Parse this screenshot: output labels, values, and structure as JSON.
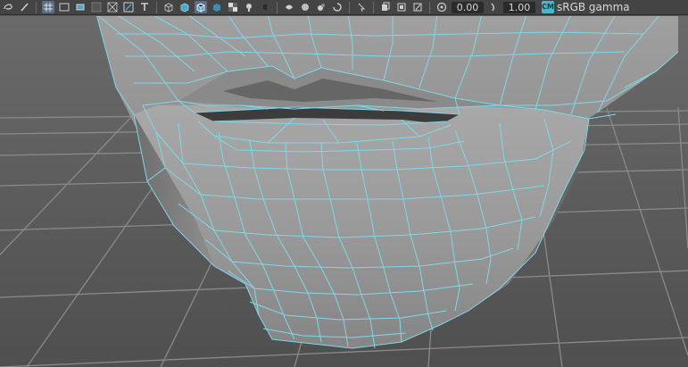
{
  "toolbar": {
    "left_icons": [
      "lasso-icon",
      "paint-brush-icon",
      "grid-icon",
      "film-gate-icon",
      "resolution-gate-icon",
      "gate-mask-icon",
      "field-chart-icon",
      "safe-action-icon",
      "safe-title-icon"
    ],
    "shading_icons": [
      "wireframe-cube-icon",
      "smooth-shade-cube-icon",
      "wireframe-on-shaded-icon",
      "default-material-icon",
      "textured-icon"
    ],
    "lighting_icons": [
      "use-all-lights-icon",
      "shadows-icon",
      "ambient-occlusion-icon",
      "motion-blur-icon"
    ],
    "display_icons": [
      "xray-icon",
      "isolate-select-icon",
      "xray-joints-icon",
      "xray-active-icon"
    ],
    "exposure_icon": "exposure-icon",
    "exposure_value": "0.00",
    "gamma_icon": "gamma-icon",
    "gamma_value": "1.00",
    "color_mgmt_icon": "color-management-icon",
    "color_mgmt_badge": "CM",
    "color_space_label": "sRGB gamma"
  },
  "viewport": {
    "background_color": "#5a5a5a",
    "grid_color": "#8a8a8a",
    "wire_color": "#7fd8e8",
    "mesh_color": "#9a9a9a",
    "mesh_name": "lower-face-mesh"
  }
}
